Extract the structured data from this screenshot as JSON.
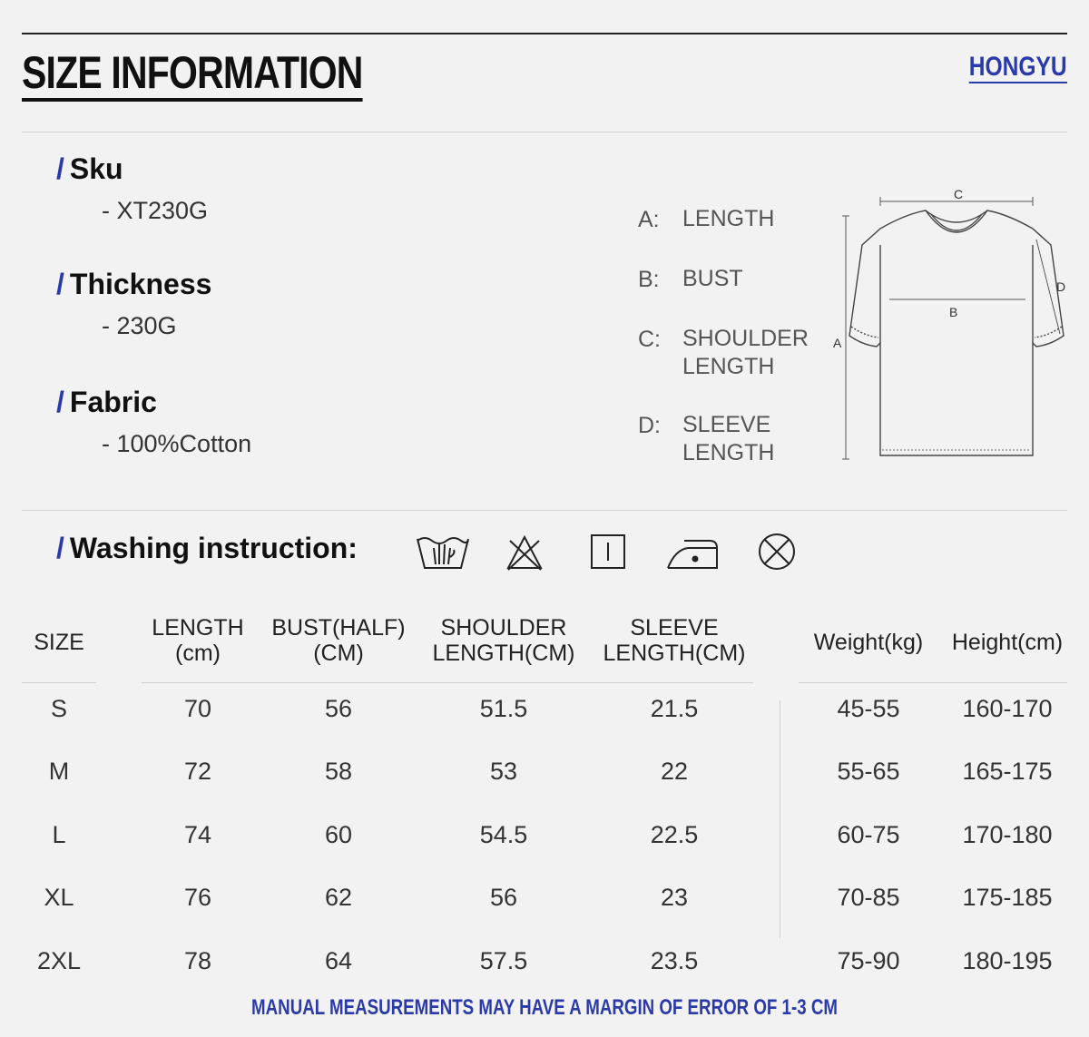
{
  "header": {
    "title": "SIZE INFORMATION",
    "brand": "HONGYU"
  },
  "specs": [
    {
      "label": "Sku",
      "value": "- XT230G"
    },
    {
      "label": "Thickness",
      "value": "- 230G"
    },
    {
      "label": "Fabric",
      "value": "- 100%Cotton"
    }
  ],
  "legend": [
    {
      "key": "A:",
      "value": "LENGTH"
    },
    {
      "key": "B:",
      "value": "BUST"
    },
    {
      "key": "C:",
      "value": "SHOULDER\nLENGTH"
    },
    {
      "key": "D:",
      "value": "SLEEVE\nLENGTH"
    }
  ],
  "diagram": {
    "label_a": "A",
    "label_b": "B",
    "label_c": "C",
    "label_d": "D"
  },
  "washing": {
    "title": "Washing instruction:",
    "icons": [
      "hand-wash-icon",
      "no-bleach-icon",
      "line-dry-icon",
      "iron-low-icon",
      "no-tumble-dry-icon"
    ]
  },
  "table": {
    "headers": [
      "SIZE",
      "LENGTH\n(cm)",
      "BUST(HALF)\n(CM)",
      "SHOULDER\nLENGTH(CM)",
      "SLEEVE\nLENGTH(CM)",
      "Weight(kg)",
      "Height(cm)"
    ],
    "rows": [
      [
        "S",
        "70",
        "56",
        "51.5",
        "21.5",
        "45-55",
        "160-170"
      ],
      [
        "M",
        "72",
        "58",
        "53",
        "22",
        "55-65",
        "165-175"
      ],
      [
        "L",
        "74",
        "60",
        "54.5",
        "22.5",
        "60-75",
        "170-180"
      ],
      [
        "XL",
        "76",
        "62",
        "56",
        "23",
        "70-85",
        "175-185"
      ],
      [
        "2XL",
        "78",
        "64",
        "57.5",
        "23.5",
        "75-90",
        "180-195"
      ]
    ]
  },
  "footer": "MANUAL MEASUREMENTS MAY HAVE A MARGIN OF ERROR OF 1-3 CM",
  "colors": {
    "accent": "#2a3aa8",
    "background": "#f2f2f2",
    "text": "#222222"
  }
}
